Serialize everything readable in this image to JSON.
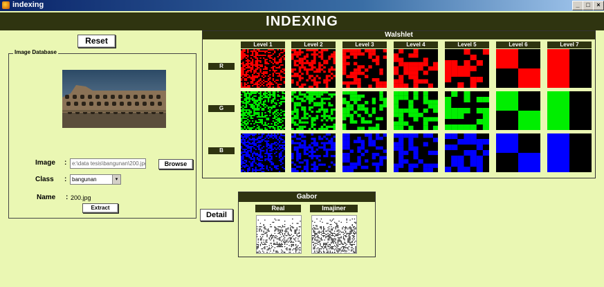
{
  "window": {
    "title": "indexing",
    "minimize_glyph": "_",
    "maximize_glyph": "□",
    "close_glyph": "×"
  },
  "header": {
    "title": "INDEXING"
  },
  "reset_label": "Reset",
  "database": {
    "legend": "Image Database",
    "image_label": "Image",
    "image_colon": ":",
    "image_path": "e:\\data tesis\\bangunan\\200.jpg",
    "browse_label": "Browse",
    "class_label": "Class",
    "class_colon": ":",
    "class_value": "bangunan",
    "name_label": "Name",
    "name_colon": ":",
    "name_value": "200.jpg",
    "extract_label": "Extract"
  },
  "detail_label": "Detail",
  "walshlet": {
    "title": "Walshlet",
    "levels": [
      "Level 1",
      "Level 2",
      "Level 3",
      "Level 4",
      "Level 5",
      "Level 6",
      "Level 7"
    ],
    "channels": [
      {
        "label": "R",
        "color": "#ff0000"
      },
      {
        "label": "G",
        "color": "#00ee00"
      },
      {
        "label": "B",
        "color": "#0000ff"
      }
    ]
  },
  "gabor": {
    "title": "Gabor",
    "real_label": "Real",
    "imaginer_label": "Imajiner"
  }
}
